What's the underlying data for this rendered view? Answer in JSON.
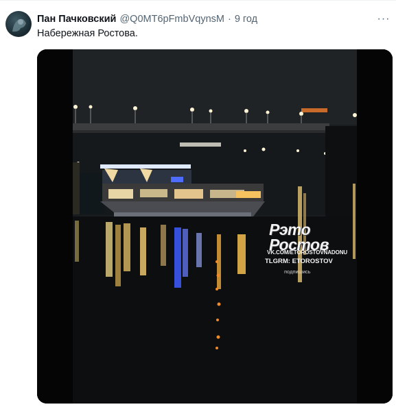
{
  "tweet": {
    "author_name": "Пан Пачковский",
    "handle": "@Q0MT6pFmbVqynsM",
    "separator": "·",
    "time": "9 год",
    "more_icon": "more-horizontal-icon",
    "text": "Набережная Ростова."
  },
  "media": {
    "watermark": {
      "logo_line1": "Рэто",
      "logo_line2": "Ростов",
      "url": "VK.COM/ETOROSTOVNADONU",
      "telegram": "TLGRM: ETOROSTOV",
      "subscribe": "подпишись"
    }
  },
  "colors": {
    "text_primary": "#0f1419",
    "text_secondary": "#536471",
    "divider": "#eff3f4",
    "media_bg": "#050505"
  }
}
